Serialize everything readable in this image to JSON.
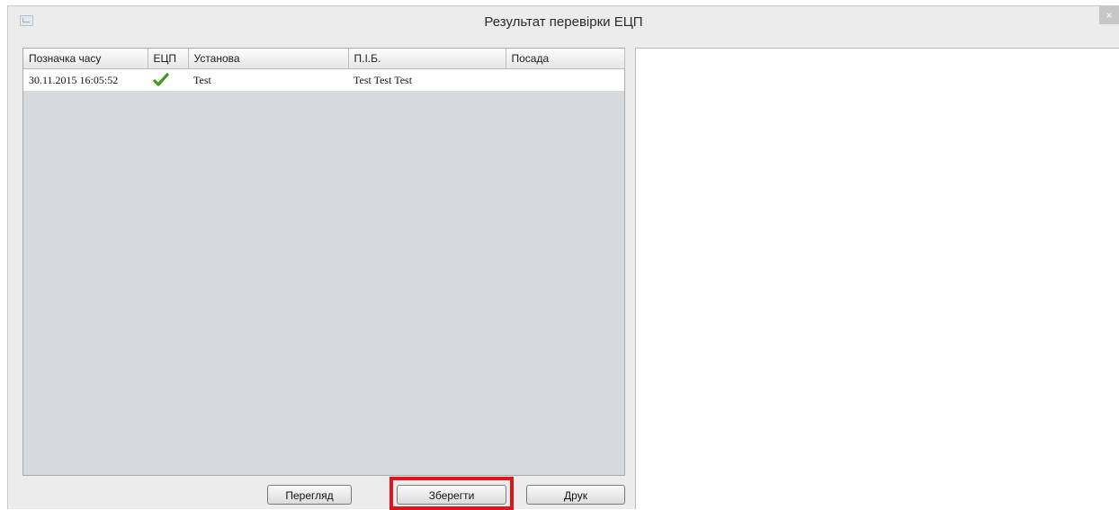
{
  "window": {
    "title": "Результат перевірки ЕЦП",
    "close_label": "×"
  },
  "table": {
    "columns": [
      "Позначка часу",
      "ЕЦП",
      "Установа",
      "П.І.Б.",
      "Посада"
    ],
    "rows": [
      {
        "timestamp": "30.11.2015 16:05:52",
        "signature_status": "valid",
        "institution": "Test",
        "full_name": "Test Test Test",
        "position": ""
      }
    ]
  },
  "buttons": {
    "view_label": "Перегляд",
    "save_label": "Зберегти",
    "print_label": "Друк"
  },
  "colors": {
    "highlight": "#e1141b",
    "check": "#3f9a1c"
  }
}
